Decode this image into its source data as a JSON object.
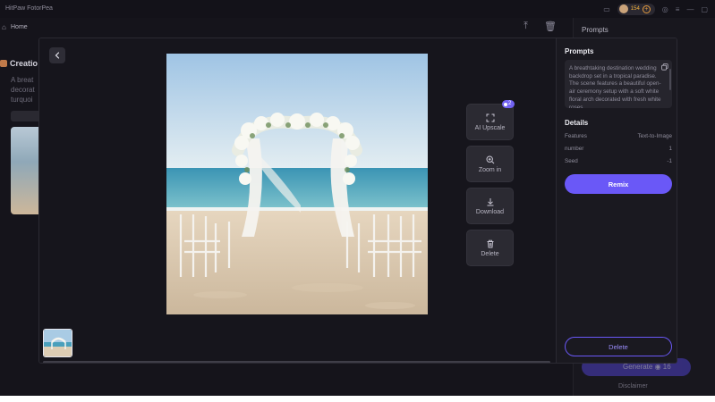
{
  "app": {
    "title": "HitPaw FotorPea"
  },
  "titlebar": {
    "coins": "154"
  },
  "nav": {
    "home_label": "Home"
  },
  "background": {
    "section_title": "Creatio",
    "text_lines": [
      "A breat",
      "decorat",
      "turquoi"
    ],
    "right_panel_title": "Prompts",
    "generate_label": "Generate",
    "generate_cost": "16",
    "disclaimer": "Disclaimer"
  },
  "viewer": {
    "image_alt": "Beach wedding arch with white flowers and chairs"
  },
  "tools": {
    "upscale_label": "AI Upscale",
    "upscale_badge": "2",
    "zoom_label": "Zoom in",
    "download_label": "Download",
    "delete_label": "Delete"
  },
  "side": {
    "prompts_title": "Prompts",
    "prompt_text": "A breathtaking destination wedding backdrop set in a tropical paradise. The scene features a beautiful open-air ceremony setup with a soft white floral arch decorated with fresh white roses",
    "details_title": "Details",
    "details": [
      {
        "key": "Features",
        "value": "Text-to-Image"
      },
      {
        "key": "number",
        "value": "1"
      },
      {
        "key": "Seed",
        "value": "-1"
      }
    ],
    "remix_label": "Remix",
    "delete_label": "Delete"
  },
  "colors": {
    "accent": "#6a58f7",
    "panel": "#1a1920",
    "background": "#15141b"
  }
}
